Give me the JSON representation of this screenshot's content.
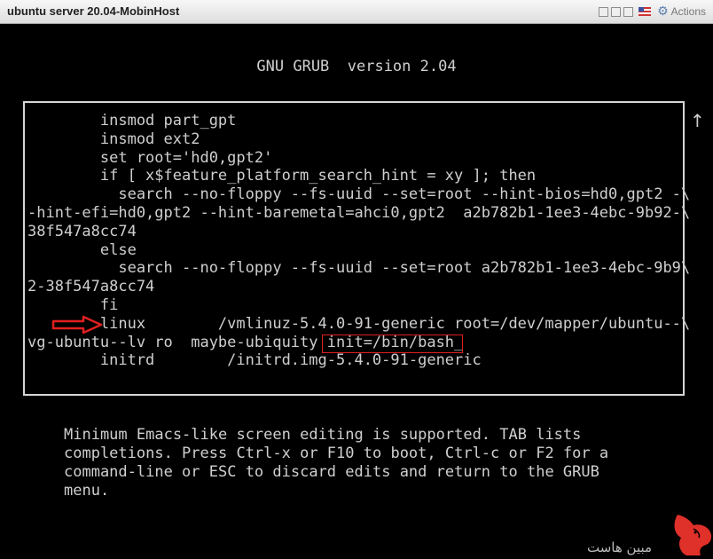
{
  "window": {
    "title": "ubuntu server 20.04-MobinHost",
    "actions_label": "Actions"
  },
  "grub": {
    "header": "GNU GRUB  version 2.04",
    "scroll_indicator": "↑",
    "lines": [
      "        insmod part_gpt",
      "        insmod ext2",
      "        set root='hd0,gpt2'",
      "        if [ x$feature_platform_search_hint = xy ]; then",
      "          search --no-floppy --fs-uuid --set=root --hint-bios=hd0,gpt2 -\\",
      "-hint-efi=hd0,gpt2 --hint-baremetal=ahci0,gpt2  a2b782b1-1ee3-4ebc-9b92-\\",
      "38f547a8cc74",
      "        else",
      "          search --no-floppy --fs-uuid --set=root a2b782b1-1ee3-4ebc-9b9\\",
      "2-38f547a8cc74",
      "        fi",
      "        linux        /vmlinuz-5.4.0-91-generic root=/dev/mapper/ubuntu--\\",
      "vg-ubuntu--lv ro  maybe-ubiquity init=/bin/bash_",
      "        initrd        /initrd.img-5.4.0-91-generic"
    ],
    "help_lines": [
      "Minimum Emacs-like screen editing is supported. TAB lists",
      "completions. Press Ctrl-x or F10 to boot, Ctrl-c or F2 for a",
      "command-line or ESC to discard edits and return to the GRUB",
      "menu."
    ]
  },
  "watermark": {
    "text": "مبین هاست",
    "color": "#e0302a"
  }
}
